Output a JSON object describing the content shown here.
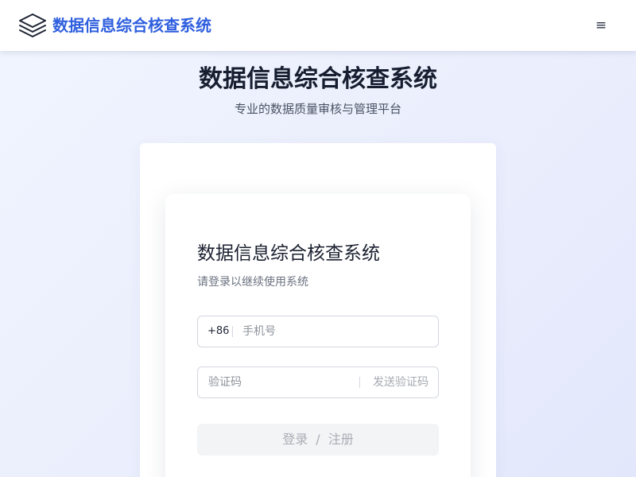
{
  "header": {
    "brand": "数据信息综合核查系统",
    "logo_icon": "layers-icon",
    "menu_icon": "hamburger-menu-icon",
    "menu_glyph": "≡"
  },
  "hero": {
    "title": "数据信息综合核查系统",
    "subtitle": "专业的数据质量审核与管理平台"
  },
  "login": {
    "title": "数据信息综合核查系统",
    "subtitle": "请登录以继续使用系统",
    "phone": {
      "prefix": "+86",
      "value": "",
      "placeholder": "手机号"
    },
    "code": {
      "value": "",
      "placeholder": "验证码",
      "send_label": "发送验证码"
    },
    "submit": {
      "login_label": "登录",
      "separator": "/",
      "register_label": "注册"
    }
  },
  "colors": {
    "brand": "#2f5fde",
    "title": "#171e30",
    "disabled_text": "#a9adb5",
    "disabled_bg": "#f3f4f6"
  }
}
